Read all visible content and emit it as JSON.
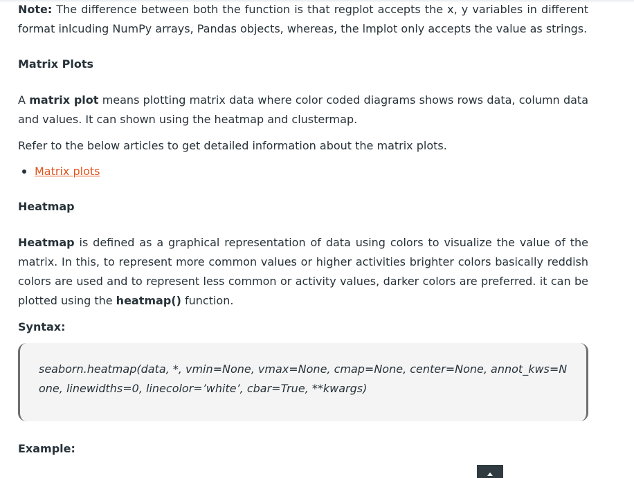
{
  "note": {
    "label": "Note:",
    "text": " The difference between both the function is that regplot accepts the x, y variables in different format inlcuding NumPy arrays, Pandas objects, whereas, the lmplot only accepts the value as strings."
  },
  "matrix_plots": {
    "title": "Matrix Plots",
    "desc_prefix": "A ",
    "desc_bold": "matrix plot",
    "desc_text": " means plotting matrix data where color coded diagrams shows rows data, column data and values. It can shown using the heatmap and clustermap.",
    "refer_text": "Refer to the below articles to get detailed information about the matrix plots.",
    "links": [
      "Matrix plots"
    ]
  },
  "heatmap": {
    "title": "Heatmap",
    "desc_bold": "Heatmap",
    "desc_text": " is defined as a graphical representation of data using colors to visualize the value of the matrix. In this, to represent more common values or higher activities brighter colors basically reddish colors are used and to represent less common or activity values, darker colors are preferred. it can be plotted using the ",
    "func_bold": "heatmap()",
    "func_suffix": " function."
  },
  "syntax": {
    "title": "Syntax:",
    "code": "seaborn.heatmap(data, *, vmin=None, vmax=None, cmap=None, center=None, annot_kws=None, linewidths=0, linecolor=’white’, cbar=True, **kwargs)"
  },
  "example": {
    "title": "Example:"
  },
  "colors": {
    "text": "#273239",
    "link": "#e0541d",
    "code_bg": "#f4f4f4",
    "code_border": "#6f6f6f",
    "scroll_button": "#2f3b40"
  },
  "icons": {
    "scroll_top": "chevron-up-icon"
  }
}
